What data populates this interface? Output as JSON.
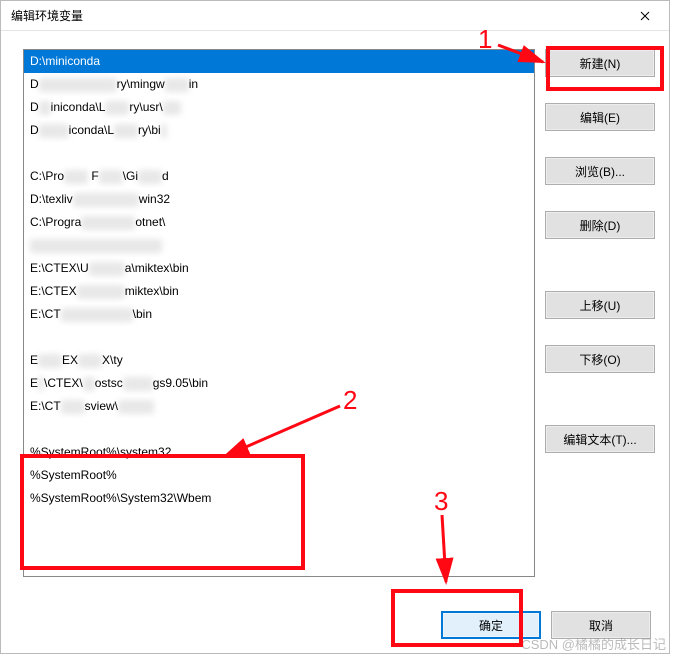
{
  "dialog": {
    "title": "编辑环境变量"
  },
  "list": {
    "items": [
      "D:\\miniconda",
      "D:\\miniconda\\Library\\mingw64\\bin",
      "D:\\miniconda\\Library\\usr\\bin",
      "D:\\miniconda\\Library\\bin",
      "",
      "C:\\Program Files\\Git\\cmd",
      "D:\\texlive\\2022\\bin\\win32",
      "C:\\Program Files\\dotnet\\",
      "",
      "E:\\CTEX\\UserData\\miktex\\bin",
      "E:\\CTEX\\MiKTeX\\miktex\\bin",
      "E:\\CTEX\\CTEX\\ctex\\bin",
      "",
      "E:\\CTEX\\CTEX\\ty",
      "E:\\CTEX\\Ghostscript\\gs9.05\\bin",
      "E:\\CTEX\\GSview\\gsview",
      "",
      "%SystemRoot%\\system32",
      "%SystemRoot%",
      "%SystemRoot%\\System32\\Wbem"
    ],
    "displayItems": [
      {
        "pre": "D:\\miniconda",
        "blur": 0,
        "post": ""
      },
      {
        "pre": "D",
        "blurMid": "\\miniconda\\Li",
        "mid": "ry\\mingw",
        "blurMid2": "64\\b",
        "post": "in"
      },
      {
        "pre": "D",
        "blurMid": "\\m",
        "mid": "iniconda\\L",
        "blurMid2": "ibra",
        "mid2": "ry\\usr\\",
        "blurMid3": "bin",
        "post": ""
      },
      {
        "pre": "D",
        "blurMid": ":\\min",
        "mid": "iconda\\L",
        "blurMid2": "ibra",
        "mid2": "ry\\bi",
        "blurMid3": "n",
        "post": ""
      },
      {
        "pre": "",
        "blur": 0,
        "post": ""
      },
      {
        "pre": "C:\\Pro",
        "blurMid": "gram",
        "mid": " F",
        "blurMid2": "iles",
        "mid2": "\\Gi",
        "blurMid3": "t\\cm",
        "post": "d"
      },
      {
        "pre": "D:\\texliv",
        "blurMid": "e\\2022\\bin\\",
        "post": "win32"
      },
      {
        "pre": "C:\\Progra",
        "blurMid": "m Files\\d",
        "post": "otnet\\"
      },
      {
        "pre": "",
        "blurMid": "xxxxxxxxxxxxxxxxxxxxxx",
        "post": ""
      },
      {
        "pre": "E:\\CTEX\\U",
        "blurMid": "serDat",
        "post": "a\\miktex\\bin"
      },
      {
        "pre": "E:\\CTEX",
        "blurMid": "\\MiKTeX\\",
        "post": "miktex\\bin"
      },
      {
        "pre": "E:\\CT",
        "blurMid": "EX\\CTEX\\ctex",
        "post": "\\bin"
      },
      {
        "pre": "",
        "blur": 0,
        "post": ""
      },
      {
        "pre": "E",
        "blurMid": ":\\CT",
        "mid": "EX",
        "blurMid2": "\\CTE",
        "post": "X\\ty"
      },
      {
        "pre": "E",
        "blurMid": ":",
        "mid": "\\CTEX\\",
        "blurMid2": "Gh",
        "mid2": "ostsc",
        "blurMid3": "ript\\",
        "post": "gs9.05\\bin"
      },
      {
        "pre": "E:\\CT",
        "blurMid": "EX\\G",
        "mid": "sview\\",
        "blurMid2": "gsview",
        "post": ""
      },
      {
        "pre": "",
        "blur": 0,
        "post": ""
      },
      {
        "pre": "%SystemRoot%\\system32",
        "blur": 0,
        "post": ""
      },
      {
        "pre": "%SystemRoot%",
        "blur": 0,
        "post": ""
      },
      {
        "pre": "%SystemRoot%\\System32\\Wbem",
        "blur": 0,
        "post": ""
      }
    ]
  },
  "buttons": {
    "new": "新建(N)",
    "edit": "编辑(E)",
    "browse": "浏览(B)...",
    "delete": "删除(D)",
    "moveup": "上移(U)",
    "movedown": "下移(O)",
    "edittext": "编辑文本(T)...",
    "ok": "确定",
    "cancel": "取消"
  },
  "annotations": {
    "num1": "1",
    "num2": "2",
    "num3": "3"
  },
  "watermark": "CSDN @橘橘的成长日记"
}
